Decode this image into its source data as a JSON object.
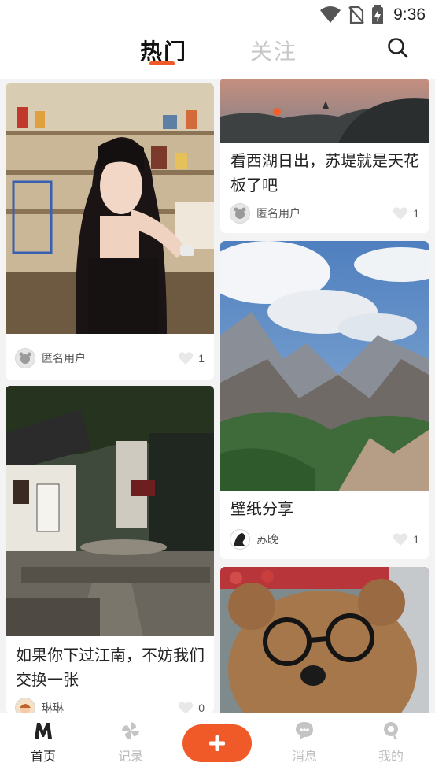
{
  "status_bar": {
    "time": "9:36"
  },
  "header": {
    "tabs": [
      "热门",
      "关注"
    ]
  },
  "feed": {
    "left": [
      {
        "title": "",
        "author": "匿名用户",
        "likes": "1"
      },
      {
        "title": "如果你下过江南，不妨我们交换一张",
        "author": "琳琳",
        "likes": "0"
      }
    ],
    "right": [
      {
        "title": "看西湖日出，苏堤就是天花板了吧",
        "author": "匿名用户",
        "likes": "1"
      },
      {
        "title": "壁纸分享",
        "author": "苏晚",
        "likes": "1"
      },
      {
        "title": "",
        "author": "",
        "likes": ""
      }
    ]
  },
  "bottom_nav": {
    "home": "首页",
    "record": "记录",
    "messages": "消息",
    "mine": "我的"
  },
  "colors": {
    "accent": "#f05a28",
    "inactive": "#bcbcbc"
  },
  "icons": [
    "wifi-icon",
    "no-sim-icon",
    "battery-charging-icon",
    "search-icon",
    "avatar-icon",
    "heart-icon",
    "home-m-icon",
    "pinwheel-icon",
    "plus-icon",
    "chat-icon",
    "profile-icon"
  ]
}
